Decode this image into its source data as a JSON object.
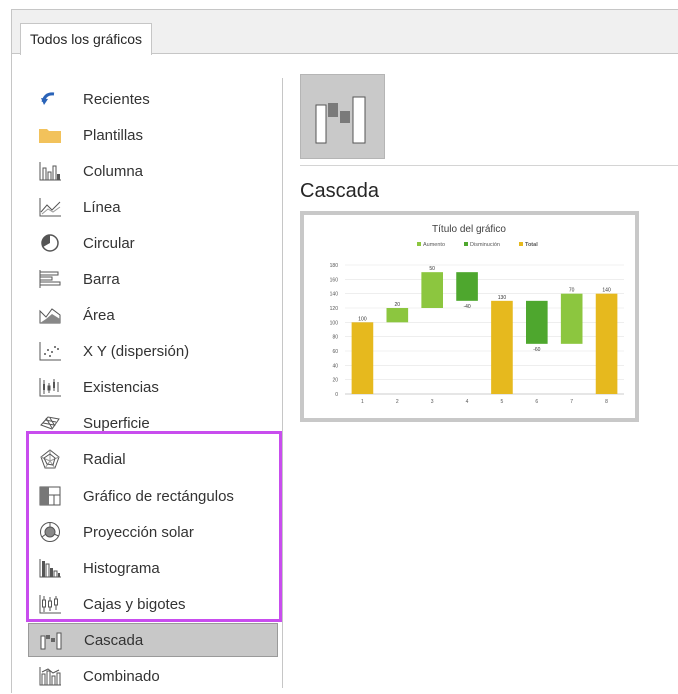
{
  "tab": {
    "label": "Todos los gráficos"
  },
  "sidebar": {
    "items": [
      {
        "label": "Recientes",
        "icon": "recent-icon"
      },
      {
        "label": "Plantillas",
        "icon": "folder-icon"
      },
      {
        "label": "Columna",
        "icon": "column-chart-icon"
      },
      {
        "label": "Línea",
        "icon": "line-chart-icon"
      },
      {
        "label": "Circular",
        "icon": "pie-chart-icon"
      },
      {
        "label": "Barra",
        "icon": "bar-chart-icon"
      },
      {
        "label": "Área",
        "icon": "area-chart-icon"
      },
      {
        "label": "X Y (dispersión)",
        "icon": "scatter-chart-icon"
      },
      {
        "label": "Existencias",
        "icon": "stock-chart-icon"
      },
      {
        "label": "Superficie",
        "icon": "surface-chart-icon"
      },
      {
        "label": "Radial",
        "icon": "radar-chart-icon"
      },
      {
        "label": "Gráfico de rectángulos",
        "icon": "treemap-chart-icon"
      },
      {
        "label": "Proyección solar",
        "icon": "sunburst-chart-icon"
      },
      {
        "label": "Histograma",
        "icon": "histogram-chart-icon"
      },
      {
        "label": "Cajas y bigotes",
        "icon": "box-whisker-chart-icon"
      },
      {
        "label": "Cascada",
        "icon": "waterfall-chart-icon",
        "selected": true
      },
      {
        "label": "Combinado",
        "icon": "combo-chart-icon"
      }
    ]
  },
  "main": {
    "subtype_icon": "waterfall-subtype-icon",
    "title": "Cascada"
  },
  "colors": {
    "increase": "#8cc63f",
    "decrease": "#4ea72e",
    "total": "#e6b91e",
    "highlight": "#c84dee"
  },
  "chart_data": {
    "type": "bar",
    "subtype": "waterfall",
    "title": "Título del gráfico",
    "legend": [
      "Aumento",
      "Disminución",
      "Total"
    ],
    "legend_position": "top",
    "categories": [
      "1",
      "2",
      "3",
      "4",
      "5",
      "6",
      "7",
      "8"
    ],
    "bars": [
      {
        "category": "1",
        "start": 0,
        "end": 100,
        "kind": "total",
        "label": "100"
      },
      {
        "category": "2",
        "start": 100,
        "end": 120,
        "kind": "increase",
        "label": "20"
      },
      {
        "category": "3",
        "start": 120,
        "end": 170,
        "kind": "increase",
        "label": "50"
      },
      {
        "category": "4",
        "start": 170,
        "end": 130,
        "kind": "decrease",
        "label": "-40"
      },
      {
        "category": "5",
        "start": 0,
        "end": 130,
        "kind": "total",
        "label": "130"
      },
      {
        "category": "6",
        "start": 130,
        "end": 70,
        "kind": "decrease",
        "label": "-60"
      },
      {
        "category": "7",
        "start": 70,
        "end": 140,
        "kind": "increase",
        "label": "70"
      },
      {
        "category": "8",
        "start": 0,
        "end": 140,
        "kind": "total",
        "label": "140"
      }
    ],
    "yticks": [
      "0",
      "20",
      "40",
      "60",
      "80",
      "100",
      "120",
      "140",
      "160",
      "180"
    ],
    "ylim": [
      0,
      180
    ],
    "grid": true
  }
}
